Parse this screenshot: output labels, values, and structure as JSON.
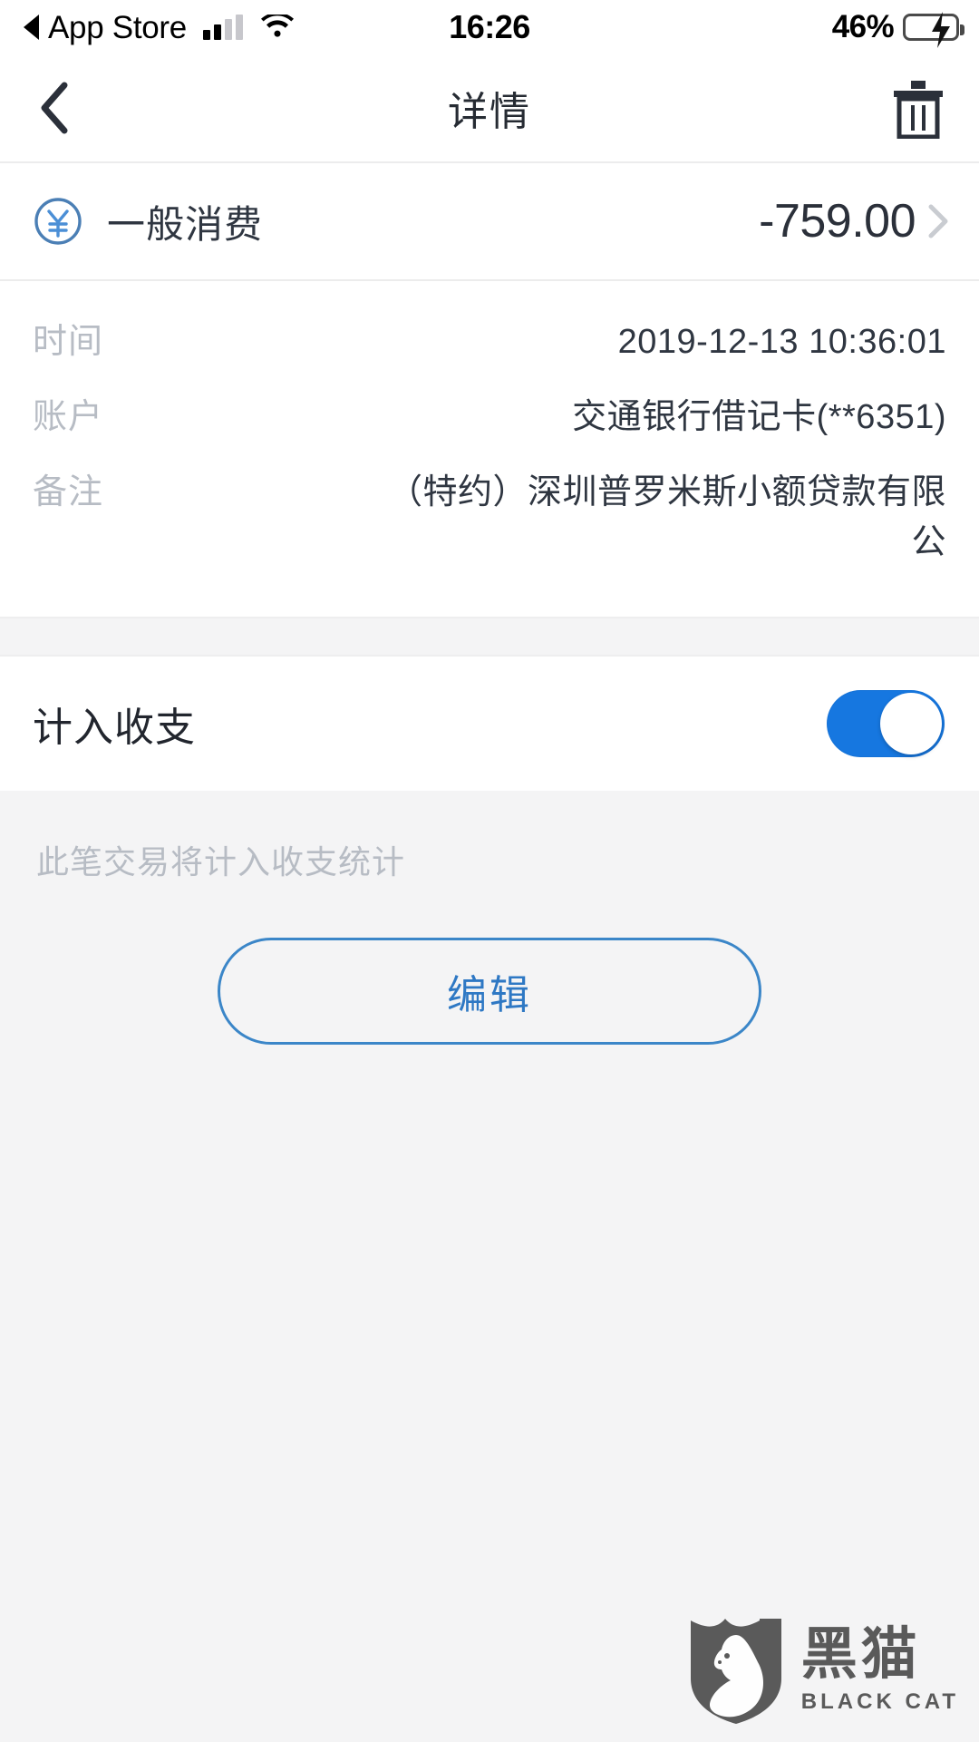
{
  "status_bar": {
    "back_app_label": "App Store",
    "back_icon": "triangle-left-icon",
    "signal_icon": "cellular-signal-icon",
    "wifi_icon": "wifi-icon",
    "time": "16:26",
    "battery_percent": "46%",
    "battery_icon": "battery-charging-icon",
    "battery_level": 46
  },
  "nav_bar": {
    "back_icon": "chevron-left-icon",
    "title": "详情",
    "delete_icon": "trash-icon"
  },
  "transaction": {
    "category_icon": "yen-circle-icon",
    "category_name": "一般消费",
    "amount": "-759.00",
    "disclosure_icon": "chevron-right-icon",
    "details": [
      {
        "label": "时间",
        "value": "2019-12-13 10:36:01"
      },
      {
        "label": "账户",
        "value": "交通银行借记卡(**6351)"
      },
      {
        "label": "备注",
        "value": "（特约）深圳普罗米斯小额贷款有限公"
      }
    ]
  },
  "include_section": {
    "toggle_label": "计入收支",
    "toggle_on": true,
    "hint": "此笔交易将计入收支统计"
  },
  "actions": {
    "edit_label": "编辑"
  },
  "watermark": {
    "logo_icon": "black-cat-shield-logo",
    "cn_text": "黑猫",
    "en_text": "BLACK CAT"
  },
  "colors": {
    "accent_blue": "#1677e0",
    "edit_blue": "#2e78c4",
    "amount": "#2b303a",
    "label_gray": "#b7bcc4",
    "page_bg": "#f4f4f5",
    "card_bg": "#ffffff",
    "battery_green": "#31cd41"
  }
}
